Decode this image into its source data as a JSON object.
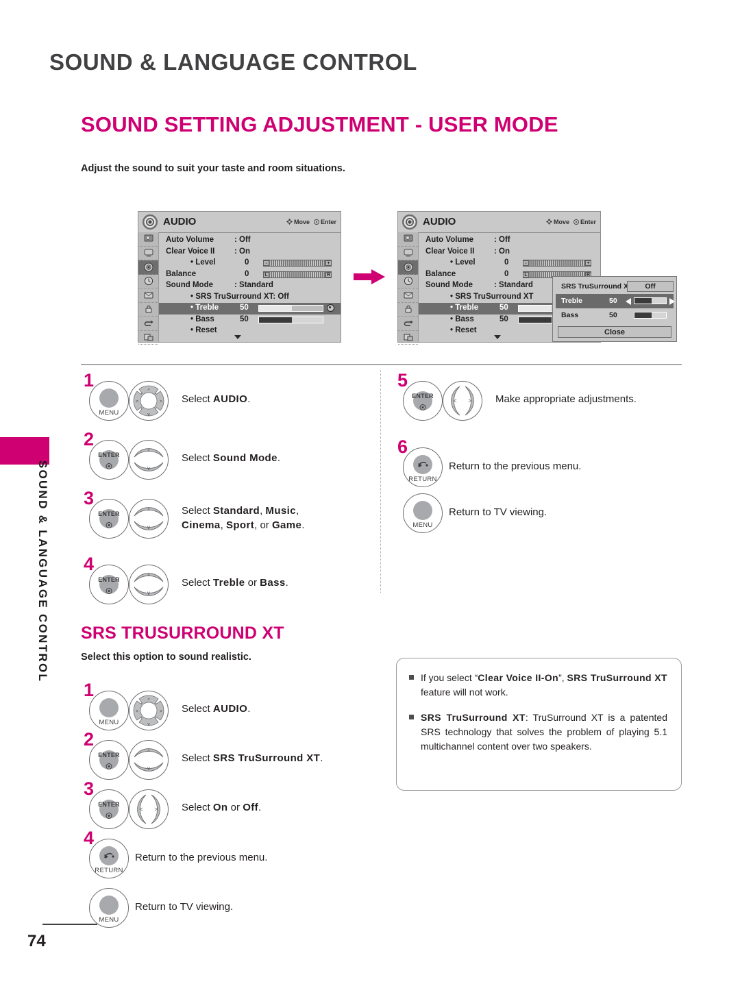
{
  "sidebar": {
    "vertical_label": "SOUND & LANGUAGE CONTROL",
    "accent_color": "#ce0072"
  },
  "header": {
    "chapter_title": "SOUND & LANGUAGE CONTROL",
    "section_title": "SOUND SETTING ADJUSTMENT - USER MODE",
    "intro": "Adjust the sound to suit your taste and room situations."
  },
  "page_number": "74",
  "osd_left": {
    "title": "AUDIO",
    "hint_move": "Move",
    "hint_enter": "Enter",
    "rows": [
      {
        "label": "Auto Volume",
        "value": ": Off"
      },
      {
        "label": "Clear Voice II",
        "value": ": On"
      },
      {
        "label": "• Level",
        "number": "0",
        "indent": true,
        "bar": "level"
      },
      {
        "label": "Balance",
        "number": "0",
        "bar": "balance"
      },
      {
        "label": "Sound Mode",
        "value": ": Standard"
      },
      {
        "label": "• SRS TruSurround XT: Off",
        "indent": true
      },
      {
        "label": "• Treble",
        "number": "50",
        "indent": true,
        "bar": "treble",
        "highlight": true
      },
      {
        "label": "• Bass",
        "number": "50",
        "indent": true,
        "bar": "bass"
      },
      {
        "label": "• Reset",
        "indent": true,
        "caret": true
      }
    ]
  },
  "osd_right": {
    "title": "AUDIO",
    "hint_move": "Move",
    "hint_enter": "Enter",
    "rows": [
      {
        "label": "Auto Volume",
        "value": ": Off"
      },
      {
        "label": "Clear Voice II",
        "value": ": On"
      },
      {
        "label": "• Level",
        "number": "0",
        "indent": true,
        "bar": "level"
      },
      {
        "label": "Balance",
        "number": "0",
        "bar": "balance"
      },
      {
        "label": "Sound Mode",
        "value": ": Standard"
      },
      {
        "label": "• SRS TruSurround XT",
        "indent": true
      },
      {
        "label": "• Treble",
        "number": "50",
        "indent": true,
        "bar": "treble",
        "highlight": true
      },
      {
        "label": "• Bass",
        "number": "50",
        "indent": true,
        "bar": "bass"
      },
      {
        "label": "• Reset",
        "indent": true,
        "caret": true
      }
    ]
  },
  "popup": {
    "srs_label": "SRS TruSurround XT",
    "srs_value": "Off",
    "treble_label": "Treble",
    "treble_value": "50",
    "bass_label": "Bass",
    "bass_value": "50",
    "close_label": "Close"
  },
  "steps_left": [
    {
      "num": "1",
      "button": "MENU",
      "pad": "dpad4",
      "text_html": "Select <b>AUDIO</b>."
    },
    {
      "num": "2",
      "button": "ENTER",
      "pad": "updown",
      "text_html": "Select <b>Sound Mode</b>."
    },
    {
      "num": "3",
      "button": "ENTER",
      "pad": "updown",
      "text_html": "Select <b>Standard</b>, <b>Music</b>,<br><b>Cinema</b>, <b>Sport</b>, or <b>Game</b>."
    },
    {
      "num": "4",
      "button": "ENTER",
      "pad": "updown",
      "text_html": "Select <b>Treble</b> or <b>Bass</b>."
    }
  ],
  "steps_right": [
    {
      "num": "5",
      "button": "ENTER",
      "pad": "leftright",
      "text_html": "Make appropriate adjustments."
    },
    {
      "num": "6",
      "button": "RETURN",
      "pad": "",
      "text_html": "Return to the previous menu."
    },
    {
      "num": "",
      "button": "MENU",
      "pad": "",
      "text_html": "Return to TV viewing."
    }
  ],
  "srs_section": {
    "title": "SRS TRUSURROUND XT",
    "subtitle": "Select this option to sound realistic.",
    "steps": [
      {
        "num": "1",
        "button": "MENU",
        "pad": "dpad4",
        "text_html": "Select <b>AUDIO</b>."
      },
      {
        "num": "2",
        "button": "ENTER",
        "pad": "updown",
        "text_html": "Select <b>SRS TruSurround XT</b>."
      },
      {
        "num": "3",
        "button": "ENTER",
        "pad": "leftright",
        "text_html": "Select <b>On</b> or <b>Off</b>."
      },
      {
        "num": "4",
        "button": "RETURN",
        "pad": "",
        "text_html": "Return to the previous menu."
      },
      {
        "num": "",
        "button": "MENU",
        "pad": "",
        "text_html": "Return to TV viewing."
      }
    ]
  },
  "notes": [
    "If you select “<b>Clear Voice II-On</b>”, <b>SRS TruSurround XT</b> feature will not work.",
    "<b>SRS TruSurround XT</b>: TruSurround XT is a patented SRS technology that solves the problem of playing 5.1 multichannel content over two speakers."
  ]
}
